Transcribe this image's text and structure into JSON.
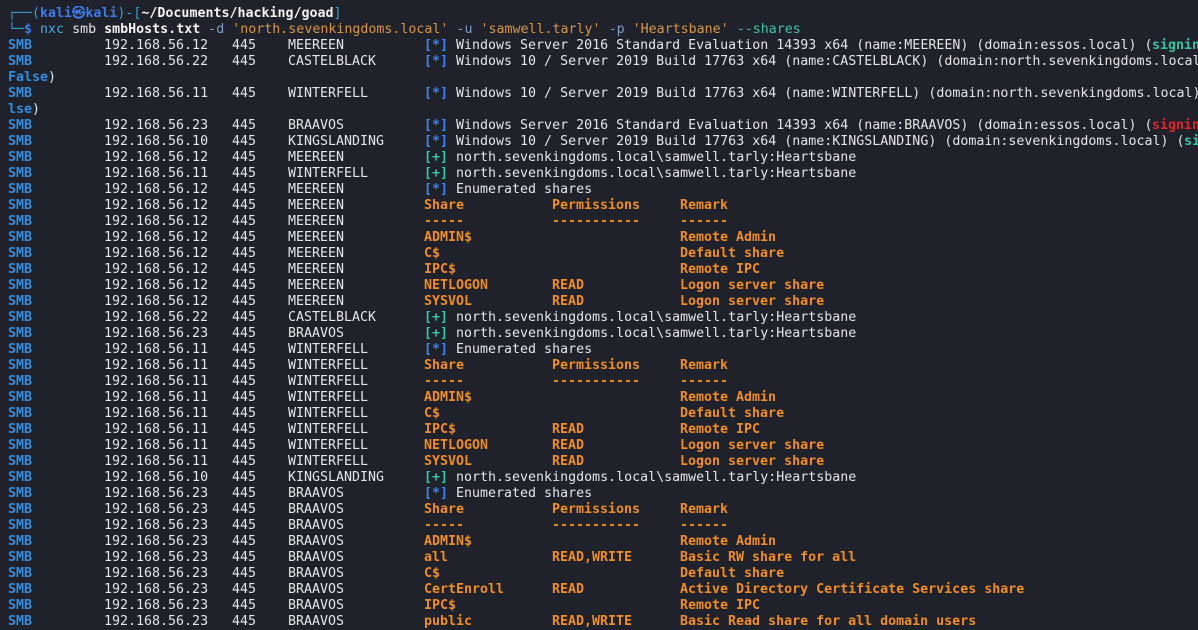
{
  "prompt": {
    "open": "┌──(",
    "user_host": "kali㉿kali",
    "mid": ")-[",
    "path": "~/Documents/hacking/goad",
    "close": "]",
    "corner": "└─",
    "symbol": "$"
  },
  "command": {
    "bin": "nxc",
    "protocol": "smb",
    "target": "smbHosts.txt",
    "domain_flag": "-d",
    "domain": "'north.sevenkingdoms.local'",
    "user_flag": "-u",
    "user": "'samwell.tarly'",
    "pass_flag": "-p",
    "password": "'Heartsbane'",
    "shares_flag": "--shares"
  },
  "colors": {
    "background": "#1f222a",
    "module": "#2f8ee0",
    "info": "#3f86ee",
    "success": "#36c3a6",
    "share": "#f08d25",
    "signing_false": "#e0262a"
  },
  "rows": [
    {
      "kind": "host",
      "module": "SMB",
      "ip": "192.168.56.12",
      "port": "445",
      "host": "MEEREEN",
      "tag": "[*]",
      "tag_type": "info",
      "text": "Windows Server 2016 Standard Evaluation 14393 x64 (name:MEEREEN) (domain:essos.local) (",
      "tail": "signing",
      "tail_type": "ok"
    },
    {
      "kind": "host",
      "module": "SMB",
      "ip": "192.168.56.22",
      "port": "445",
      "host": "CASTELBLACK",
      "tag": "[*]",
      "tag_type": "info",
      "text": "Windows 10 / Server 2019 Build 17763 x64 (name:CASTELBLACK) (domain:north.sevenkingdoms.local"
    },
    {
      "kind": "wrap",
      "head": "False",
      "rest": ")"
    },
    {
      "kind": "host",
      "module": "SMB",
      "ip": "192.168.56.11",
      "port": "445",
      "host": "WINTERFELL",
      "tag": "[*]",
      "tag_type": "info",
      "text": "Windows 10 / Server 2019 Build 17763 x64 (name:WINTERFELL) (domain:north.sevenkingdoms.local)"
    },
    {
      "kind": "wrap",
      "head": "lse",
      "rest": ")"
    },
    {
      "kind": "host",
      "module": "SMB",
      "ip": "192.168.56.23",
      "port": "445",
      "host": "BRAAVOS",
      "tag": "[*]",
      "tag_type": "info",
      "text": "Windows Server 2016 Standard Evaluation 14393 x64 (name:BRAAVOS) (domain:essos.local) (",
      "tail": "signing",
      "tail_type": "red"
    },
    {
      "kind": "host",
      "module": "SMB",
      "ip": "192.168.56.10",
      "port": "445",
      "host": "KINGSLANDING",
      "tag": "[*]",
      "tag_type": "info",
      "text": "Windows 10 / Server 2019 Build 17763 x64 (name:KINGSLANDING) (domain:sevenkingdoms.local) (",
      "tail": "si",
      "tail_type": "ok"
    },
    {
      "kind": "host",
      "module": "SMB",
      "ip": "192.168.56.12",
      "port": "445",
      "host": "MEEREEN",
      "tag": "[+]",
      "tag_type": "ok",
      "text": "north.sevenkingdoms.local\\samwell.tarly:Heartsbane"
    },
    {
      "kind": "host",
      "module": "SMB",
      "ip": "192.168.56.11",
      "port": "445",
      "host": "WINTERFELL",
      "tag": "[+]",
      "tag_type": "ok",
      "text": "north.sevenkingdoms.local\\samwell.tarly:Heartsbane"
    },
    {
      "kind": "host",
      "module": "SMB",
      "ip": "192.168.56.12",
      "port": "445",
      "host": "MEEREEN",
      "tag": "[*]",
      "tag_type": "info",
      "text": "Enumerated shares"
    },
    {
      "kind": "share",
      "module": "SMB",
      "ip": "192.168.56.12",
      "port": "445",
      "host": "MEEREEN",
      "share": "Share",
      "perm": "Permissions",
      "remark": "Remark"
    },
    {
      "kind": "share",
      "module": "SMB",
      "ip": "192.168.56.12",
      "port": "445",
      "host": "MEEREEN",
      "share": "-----",
      "perm": "-----------",
      "remark": "------"
    },
    {
      "kind": "share",
      "module": "SMB",
      "ip": "192.168.56.12",
      "port": "445",
      "host": "MEEREEN",
      "share": "ADMIN$",
      "perm": "",
      "remark": "Remote Admin"
    },
    {
      "kind": "share",
      "module": "SMB",
      "ip": "192.168.56.12",
      "port": "445",
      "host": "MEEREEN",
      "share": "C$",
      "perm": "",
      "remark": "Default share"
    },
    {
      "kind": "share",
      "module": "SMB",
      "ip": "192.168.56.12",
      "port": "445",
      "host": "MEEREEN",
      "share": "IPC$",
      "perm": "",
      "remark": "Remote IPC"
    },
    {
      "kind": "share",
      "module": "SMB",
      "ip": "192.168.56.12",
      "port": "445",
      "host": "MEEREEN",
      "share": "NETLOGON",
      "perm": "READ",
      "remark": "Logon server share"
    },
    {
      "kind": "share",
      "module": "SMB",
      "ip": "192.168.56.12",
      "port": "445",
      "host": "MEEREEN",
      "share": "SYSVOL",
      "perm": "READ",
      "remark": "Logon server share"
    },
    {
      "kind": "host",
      "module": "SMB",
      "ip": "192.168.56.22",
      "port": "445",
      "host": "CASTELBLACK",
      "tag": "[+]",
      "tag_type": "ok",
      "text": "north.sevenkingdoms.local\\samwell.tarly:Heartsbane"
    },
    {
      "kind": "host",
      "module": "SMB",
      "ip": "192.168.56.23",
      "port": "445",
      "host": "BRAAVOS",
      "tag": "[+]",
      "tag_type": "ok",
      "text": "north.sevenkingdoms.local\\samwell.tarly:Heartsbane"
    },
    {
      "kind": "host",
      "module": "SMB",
      "ip": "192.168.56.11",
      "port": "445",
      "host": "WINTERFELL",
      "tag": "[*]",
      "tag_type": "info",
      "text": "Enumerated shares"
    },
    {
      "kind": "share",
      "module": "SMB",
      "ip": "192.168.56.11",
      "port": "445",
      "host": "WINTERFELL",
      "share": "Share",
      "perm": "Permissions",
      "remark": "Remark"
    },
    {
      "kind": "share",
      "module": "SMB",
      "ip": "192.168.56.11",
      "port": "445",
      "host": "WINTERFELL",
      "share": "-----",
      "perm": "-----------",
      "remark": "------"
    },
    {
      "kind": "share",
      "module": "SMB",
      "ip": "192.168.56.11",
      "port": "445",
      "host": "WINTERFELL",
      "share": "ADMIN$",
      "perm": "",
      "remark": "Remote Admin"
    },
    {
      "kind": "share",
      "module": "SMB",
      "ip": "192.168.56.11",
      "port": "445",
      "host": "WINTERFELL",
      "share": "C$",
      "perm": "",
      "remark": "Default share"
    },
    {
      "kind": "share",
      "module": "SMB",
      "ip": "192.168.56.11",
      "port": "445",
      "host": "WINTERFELL",
      "share": "IPC$",
      "perm": "READ",
      "remark": "Remote IPC"
    },
    {
      "kind": "share",
      "module": "SMB",
      "ip": "192.168.56.11",
      "port": "445",
      "host": "WINTERFELL",
      "share": "NETLOGON",
      "perm": "READ",
      "remark": "Logon server share"
    },
    {
      "kind": "share",
      "module": "SMB",
      "ip": "192.168.56.11",
      "port": "445",
      "host": "WINTERFELL",
      "share": "SYSVOL",
      "perm": "READ",
      "remark": "Logon server share"
    },
    {
      "kind": "host",
      "module": "SMB",
      "ip": "192.168.56.10",
      "port": "445",
      "host": "KINGSLANDING",
      "tag": "[+]",
      "tag_type": "ok",
      "text": "north.sevenkingdoms.local\\samwell.tarly:Heartsbane"
    },
    {
      "kind": "host",
      "module": "SMB",
      "ip": "192.168.56.23",
      "port": "445",
      "host": "BRAAVOS",
      "tag": "[*]",
      "tag_type": "info",
      "text": "Enumerated shares"
    },
    {
      "kind": "share",
      "module": "SMB",
      "ip": "192.168.56.23",
      "port": "445",
      "host": "BRAAVOS",
      "share": "Share",
      "perm": "Permissions",
      "remark": "Remark"
    },
    {
      "kind": "share",
      "module": "SMB",
      "ip": "192.168.56.23",
      "port": "445",
      "host": "BRAAVOS",
      "share": "-----",
      "perm": "-----------",
      "remark": "------"
    },
    {
      "kind": "share",
      "module": "SMB",
      "ip": "192.168.56.23",
      "port": "445",
      "host": "BRAAVOS",
      "share": "ADMIN$",
      "perm": "",
      "remark": "Remote Admin"
    },
    {
      "kind": "share",
      "module": "SMB",
      "ip": "192.168.56.23",
      "port": "445",
      "host": "BRAAVOS",
      "share": "all",
      "perm": "READ,WRITE",
      "remark": "Basic RW share for all"
    },
    {
      "kind": "share",
      "module": "SMB",
      "ip": "192.168.56.23",
      "port": "445",
      "host": "BRAAVOS",
      "share": "C$",
      "perm": "",
      "remark": "Default share"
    },
    {
      "kind": "share",
      "module": "SMB",
      "ip": "192.168.56.23",
      "port": "445",
      "host": "BRAAVOS",
      "share": "CertEnroll",
      "perm": "READ",
      "remark": "Active Directory Certificate Services share"
    },
    {
      "kind": "share",
      "module": "SMB",
      "ip": "192.168.56.23",
      "port": "445",
      "host": "BRAAVOS",
      "share": "IPC$",
      "perm": "",
      "remark": "Remote IPC"
    },
    {
      "kind": "share",
      "module": "SMB",
      "ip": "192.168.56.23",
      "port": "445",
      "host": "BRAAVOS",
      "share": "public",
      "perm": "READ,WRITE",
      "remark": "Basic Read share for all domain users"
    }
  ]
}
